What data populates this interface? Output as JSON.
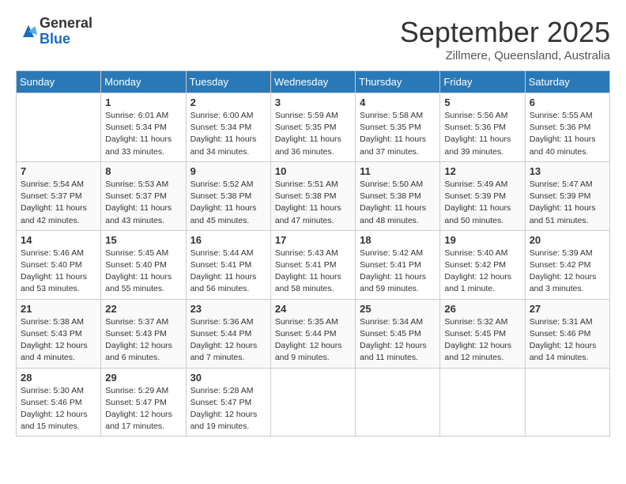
{
  "logo": {
    "general": "General",
    "blue": "Blue"
  },
  "title": "September 2025",
  "subtitle": "Zillmere, Queensland, Australia",
  "weekdays": [
    "Sunday",
    "Monday",
    "Tuesday",
    "Wednesday",
    "Thursday",
    "Friday",
    "Saturday"
  ],
  "weeks": [
    [
      {
        "day": "",
        "info": ""
      },
      {
        "day": "1",
        "info": "Sunrise: 6:01 AM\nSunset: 5:34 PM\nDaylight: 11 hours\nand 33 minutes."
      },
      {
        "day": "2",
        "info": "Sunrise: 6:00 AM\nSunset: 5:34 PM\nDaylight: 11 hours\nand 34 minutes."
      },
      {
        "day": "3",
        "info": "Sunrise: 5:59 AM\nSunset: 5:35 PM\nDaylight: 11 hours\nand 36 minutes."
      },
      {
        "day": "4",
        "info": "Sunrise: 5:58 AM\nSunset: 5:35 PM\nDaylight: 11 hours\nand 37 minutes."
      },
      {
        "day": "5",
        "info": "Sunrise: 5:56 AM\nSunset: 5:36 PM\nDaylight: 11 hours\nand 39 minutes."
      },
      {
        "day": "6",
        "info": "Sunrise: 5:55 AM\nSunset: 5:36 PM\nDaylight: 11 hours\nand 40 minutes."
      }
    ],
    [
      {
        "day": "7",
        "info": "Sunrise: 5:54 AM\nSunset: 5:37 PM\nDaylight: 11 hours\nand 42 minutes."
      },
      {
        "day": "8",
        "info": "Sunrise: 5:53 AM\nSunset: 5:37 PM\nDaylight: 11 hours\nand 43 minutes."
      },
      {
        "day": "9",
        "info": "Sunrise: 5:52 AM\nSunset: 5:38 PM\nDaylight: 11 hours\nand 45 minutes."
      },
      {
        "day": "10",
        "info": "Sunrise: 5:51 AM\nSunset: 5:38 PM\nDaylight: 11 hours\nand 47 minutes."
      },
      {
        "day": "11",
        "info": "Sunrise: 5:50 AM\nSunset: 5:38 PM\nDaylight: 11 hours\nand 48 minutes."
      },
      {
        "day": "12",
        "info": "Sunrise: 5:49 AM\nSunset: 5:39 PM\nDaylight: 11 hours\nand 50 minutes."
      },
      {
        "day": "13",
        "info": "Sunrise: 5:47 AM\nSunset: 5:39 PM\nDaylight: 11 hours\nand 51 minutes."
      }
    ],
    [
      {
        "day": "14",
        "info": "Sunrise: 5:46 AM\nSunset: 5:40 PM\nDaylight: 11 hours\nand 53 minutes."
      },
      {
        "day": "15",
        "info": "Sunrise: 5:45 AM\nSunset: 5:40 PM\nDaylight: 11 hours\nand 55 minutes."
      },
      {
        "day": "16",
        "info": "Sunrise: 5:44 AM\nSunset: 5:41 PM\nDaylight: 11 hours\nand 56 minutes."
      },
      {
        "day": "17",
        "info": "Sunrise: 5:43 AM\nSunset: 5:41 PM\nDaylight: 11 hours\nand 58 minutes."
      },
      {
        "day": "18",
        "info": "Sunrise: 5:42 AM\nSunset: 5:41 PM\nDaylight: 11 hours\nand 59 minutes."
      },
      {
        "day": "19",
        "info": "Sunrise: 5:40 AM\nSunset: 5:42 PM\nDaylight: 12 hours\nand 1 minute."
      },
      {
        "day": "20",
        "info": "Sunrise: 5:39 AM\nSunset: 5:42 PM\nDaylight: 12 hours\nand 3 minutes."
      }
    ],
    [
      {
        "day": "21",
        "info": "Sunrise: 5:38 AM\nSunset: 5:43 PM\nDaylight: 12 hours\nand 4 minutes."
      },
      {
        "day": "22",
        "info": "Sunrise: 5:37 AM\nSunset: 5:43 PM\nDaylight: 12 hours\nand 6 minutes."
      },
      {
        "day": "23",
        "info": "Sunrise: 5:36 AM\nSunset: 5:44 PM\nDaylight: 12 hours\nand 7 minutes."
      },
      {
        "day": "24",
        "info": "Sunrise: 5:35 AM\nSunset: 5:44 PM\nDaylight: 12 hours\nand 9 minutes."
      },
      {
        "day": "25",
        "info": "Sunrise: 5:34 AM\nSunset: 5:45 PM\nDaylight: 12 hours\nand 11 minutes."
      },
      {
        "day": "26",
        "info": "Sunrise: 5:32 AM\nSunset: 5:45 PM\nDaylight: 12 hours\nand 12 minutes."
      },
      {
        "day": "27",
        "info": "Sunrise: 5:31 AM\nSunset: 5:46 PM\nDaylight: 12 hours\nand 14 minutes."
      }
    ],
    [
      {
        "day": "28",
        "info": "Sunrise: 5:30 AM\nSunset: 5:46 PM\nDaylight: 12 hours\nand 15 minutes."
      },
      {
        "day": "29",
        "info": "Sunrise: 5:29 AM\nSunset: 5:47 PM\nDaylight: 12 hours\nand 17 minutes."
      },
      {
        "day": "30",
        "info": "Sunrise: 5:28 AM\nSunset: 5:47 PM\nDaylight: 12 hours\nand 19 minutes."
      },
      {
        "day": "",
        "info": ""
      },
      {
        "day": "",
        "info": ""
      },
      {
        "day": "",
        "info": ""
      },
      {
        "day": "",
        "info": ""
      }
    ]
  ]
}
